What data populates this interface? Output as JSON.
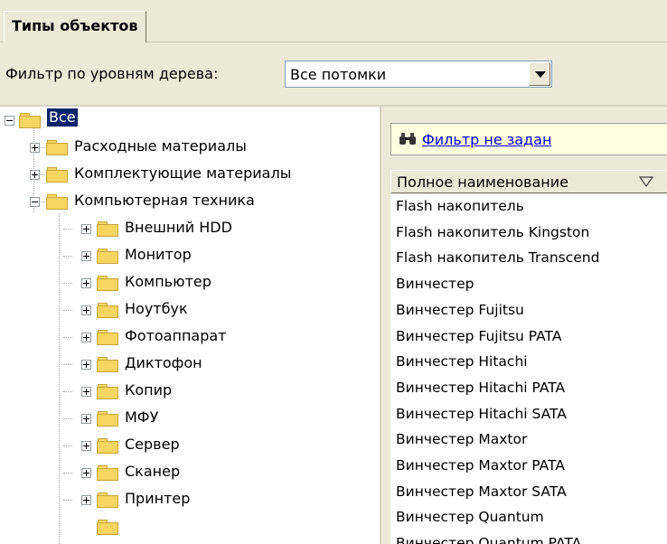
{
  "tab": {
    "label": "Типы объектов"
  },
  "filter": {
    "label": "Фильтр по уровням дерева:",
    "value": "Все потомки"
  },
  "tree": {
    "root": {
      "label": "Все"
    },
    "level1": [
      {
        "label": "Расходные материалы",
        "state": "collapsed"
      },
      {
        "label": "Комплектующие материалы",
        "state": "collapsed"
      },
      {
        "label": "Компьютерная техника",
        "state": "expanded"
      }
    ],
    "level2": [
      {
        "label": "Внешний HDD"
      },
      {
        "label": "Монитор"
      },
      {
        "label": "Компьютер"
      },
      {
        "label": "Ноутбук"
      },
      {
        "label": "Фотоаппарат"
      },
      {
        "label": "Диктофон"
      },
      {
        "label": "Копир"
      },
      {
        "label": "МФУ"
      },
      {
        "label": "Сервер"
      },
      {
        "label": "Сканер"
      },
      {
        "label": "Принтер"
      }
    ]
  },
  "list_panel": {
    "filter_link": "Фильтр не задан",
    "column_header": "Полное наименование",
    "items": [
      "Flash накопитель",
      "Flash накопитель Kingston",
      "Flash накопитель Transcend",
      "Винчестер",
      "Винчестер Fujitsu",
      "Винчестер Fujitsu PATA",
      "Винчестер Hitachi",
      "Винчестер Hitachi PATA",
      "Винчестер Hitachi SATA",
      "Винчестер Maxtor",
      "Винчестер Maxtor PATA",
      "Винчестер Maxtor SATA",
      "Винчестер Quantum",
      "Винчестер Quantum PATA"
    ]
  }
}
